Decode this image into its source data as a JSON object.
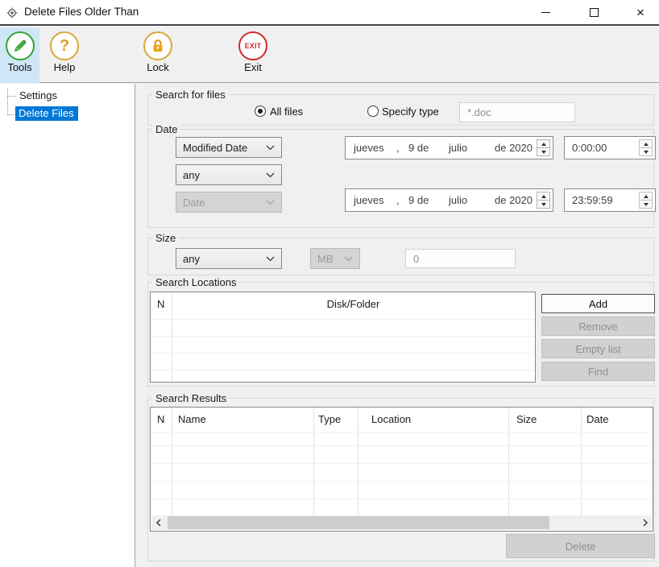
{
  "window": {
    "title": "Delete Files Older Than"
  },
  "toolbar": {
    "items": [
      {
        "label": "Tools",
        "icon": "pencil-icon",
        "selected": true
      },
      {
        "label": "Help",
        "icon": "question-icon",
        "icon_text": "?",
        "selected": false
      },
      {
        "label": "Lock",
        "icon": "padlock-icon",
        "selected": false
      },
      {
        "label": "Exit",
        "icon": "exit-badge-icon",
        "icon_text": "EXIT",
        "selected": false
      }
    ]
  },
  "sidebar": {
    "items": [
      {
        "label": "Settings",
        "selected": false
      },
      {
        "label": "Delete Files",
        "selected": true
      }
    ]
  },
  "groups": {
    "search_for_files": "Search for files",
    "date": "Date",
    "size": "Size",
    "search_locations": "Search Locations",
    "search_results": "Search Results"
  },
  "files": {
    "all_files": {
      "label": "All files",
      "checked": true
    },
    "specify_type": {
      "label": "Specify type",
      "checked": false
    },
    "type_pattern": "*.doc"
  },
  "date": {
    "field": "Modified Date",
    "condition": "any",
    "field2": "Date",
    "start": {
      "weekday": "jueves",
      "comma": ",",
      "day": "9 de",
      "month": "julio",
      "year": "de 2020",
      "time": "0:00:00"
    },
    "end": {
      "weekday": "jueves",
      "comma": ",",
      "day": "9 de",
      "month": "julio",
      "year": "de 2020",
      "time": "23:59:59"
    }
  },
  "size": {
    "condition": "any",
    "unit": "MB",
    "value": "0"
  },
  "locations": {
    "columns": [
      "N",
      "Disk/Folder"
    ],
    "rows": [],
    "buttons": [
      {
        "label": "Add",
        "enabled": true
      },
      {
        "label": "Remove",
        "enabled": false
      },
      {
        "label": "Empty list",
        "enabled": false
      },
      {
        "label": "Find",
        "enabled": false
      }
    ]
  },
  "results": {
    "columns": [
      "N",
      "Name",
      "Type",
      "Location",
      "Size",
      "Date"
    ],
    "rows": [],
    "delete_button": {
      "label": "Delete",
      "enabled": false
    }
  },
  "colors": {
    "selection_blue": "#0078d7",
    "toolbar_highlight": "#cfe6f7",
    "icon_green": "#2fa32f",
    "icon_gold": "#d8a838",
    "icon_orange": "#ec9c1c",
    "icon_red": "#cc2b2b"
  }
}
